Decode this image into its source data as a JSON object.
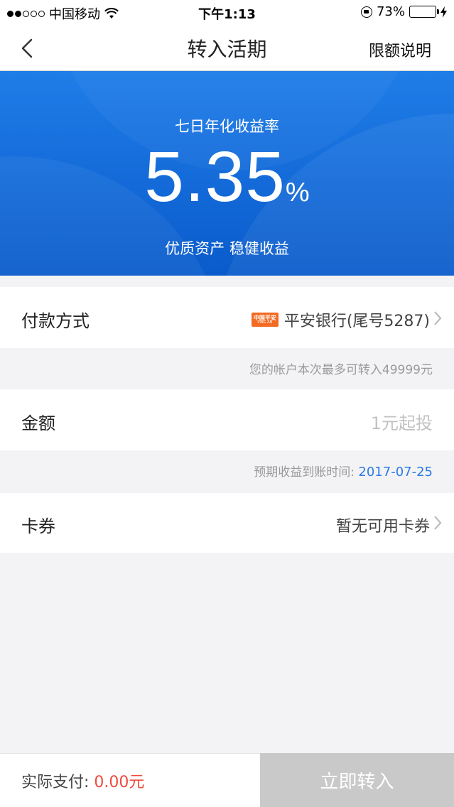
{
  "status_bar": {
    "carrier": "中国移动",
    "time": "下午1:13",
    "battery_percent": "73%",
    "battery_level": 0.73,
    "signal_dots_filled": 2,
    "signal_dots_total": 5
  },
  "nav": {
    "title": "转入活期",
    "right_link": "限额说明"
  },
  "banner": {
    "label": "七日年化收益率",
    "rate": "5.35",
    "unit": "%",
    "slogan": "优质资产  稳健收益"
  },
  "payment": {
    "label": "付款方式",
    "bank_logo_text": "中国平安",
    "bank_logo_sub": "PING AN",
    "bank": "平安银行(尾号5287)",
    "limit_hint": "您的帐户本次最多可转入49999元"
  },
  "amount": {
    "label": "金额",
    "placeholder": "1元起投",
    "arrival_hint_label": "预期收益到账时间:",
    "arrival_date": "2017-07-25"
  },
  "coupon": {
    "label": "卡券",
    "value": "暂无可用卡券"
  },
  "bottom": {
    "pay_label": "实际支付:",
    "pay_amount": "0.00元",
    "submit_label": "立即转入"
  },
  "colors": {
    "banner_top": "#1f7de8",
    "banner_bottom": "#0a5bcb",
    "accent_blue": "#2a7be3",
    "amount_red": "#f04a3c",
    "button_disabled": "#c9c9c9",
    "battery_yellow": "#f5c518",
    "bank_orange": "#f36a22"
  }
}
